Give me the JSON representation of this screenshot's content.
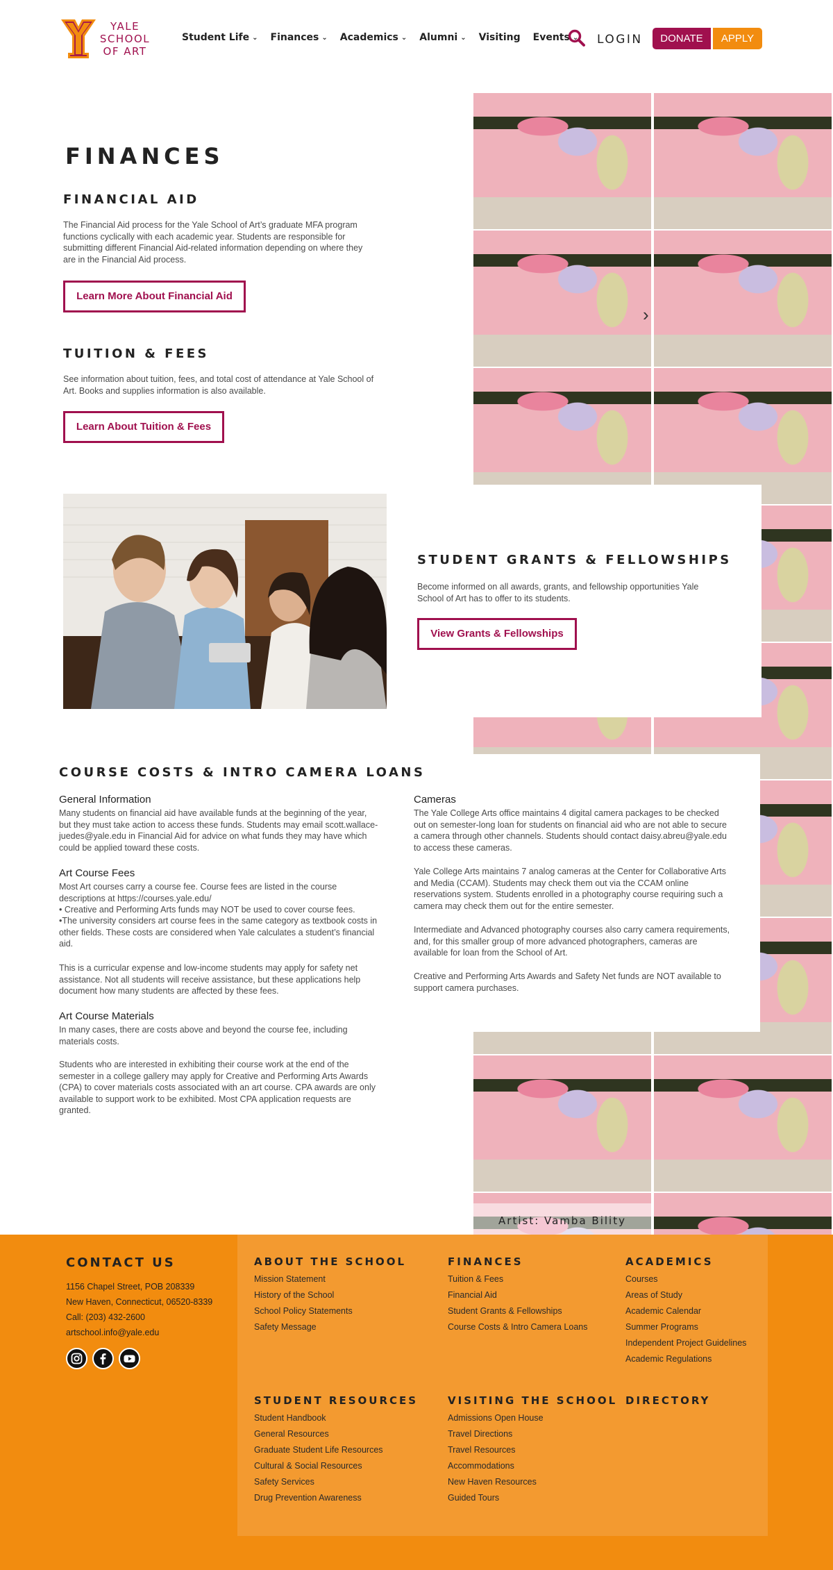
{
  "header": {
    "logo_letter": "Y",
    "logo_lines": [
      "YALE",
      "SCHOOL",
      "OF ART"
    ],
    "nav": [
      {
        "label": "Student Life",
        "dropdown": true
      },
      {
        "label": "Finances",
        "dropdown": true
      },
      {
        "label": "Academics",
        "dropdown": true
      },
      {
        "label": "Alumni",
        "dropdown": true
      },
      {
        "label": "Visiting",
        "dropdown": false
      },
      {
        "label": "Events",
        "dropdown": true
      }
    ],
    "login_label": "LOGIN",
    "donate_label": "DONATE",
    "apply_label": "APPLY"
  },
  "page_title": "FINANCES",
  "financial_aid": {
    "heading": "FINANCIAL AID",
    "body": "The Financial Aid process for the Yale School of Art’s graduate MFA program functions cyclically with each academic year. Students are responsible for submitting different Financial Aid-related information depending on where they are in the Financial Aid process.",
    "button": "Learn More About Financial Aid"
  },
  "tuition": {
    "heading": "TUITION & FEES",
    "body": "See information about tuition, fees, and total cost of attendance at Yale School of Art. Books and supplies information is also available.",
    "button": "Learn About Tuition & Fees"
  },
  "grants": {
    "heading": "STUDENT GRANTS & FELLOWSHIPS",
    "body": "Become informed on all awards, grants, and fellowship opportunities Yale School of Art has to offer to its students.",
    "button": "View Grants & Fellowships"
  },
  "course_costs": {
    "heading": "COURSE COSTS & INTRO CAMERA LOANS",
    "general_title": "General Information",
    "general_body": "Many students on financial aid have available funds at the beginning of the year, but they must take action to access these funds. Students may email scott.wallace-juedes@yale.edu in Financial Aid for advice on what funds they may have which could be applied toward these costs.",
    "fees_title": "Art Course Fees",
    "fees_body_1": "Most Art courses carry a course fee. Course fees are listed in the course descriptions at https://courses.yale.edu/",
    "fees_bullet_1": "• Creative and Performing Arts funds may NOT be used to cover course fees.",
    "fees_bullet_2": "•The university considers art course fees in the same category as textbook costs in other fields. These costs are considered when Yale calculates a student’s financial aid.",
    "fees_body_2": "This is a curricular expense and low-income students may apply for safety net assistance. Not all students will receive assistance, but these applications help document how many students are affected by these fees.",
    "materials_title": "Art Course Materials",
    "materials_body_1": "In many cases, there are costs above and beyond the course fee, including materials costs.",
    "materials_body_2": "Students who are interested in exhibiting their course work at the end of the semester in a college gallery may apply for Creative and Performing Arts Awards (CPA) to cover materials costs associated with an art course. CPA awards are only available to support work to be exhibited. Most CPA application requests are granted.",
    "cameras_title": "Cameras",
    "cameras_body_1": "The Yale College Arts office maintains 4 digital camera packages to be checked out on semester-long loan for students on financial aid who are not able to secure a camera through other channels. Students should contact daisy.abreu@yale.edu to access these cameras.",
    "cameras_body_2": "Yale College Arts maintains 7 analog cameras at the Center for Collaborative Arts and Media (CCAM). Students may check them out via the CCAM online reservations system. Students enrolled in a photography course requiring such a camera may check them out for the entire semester.",
    "cameras_body_3": "Intermediate and Advanced photography courses also carry camera requirements, and, for this smaller group of more advanced photographers, cameras are available for loan from the School of Art.",
    "cameras_body_4": "Creative and Performing Arts Awards and Safety Net funds are NOT available to support camera purchases."
  },
  "artist_credit": "Artist: Vamba Bility",
  "footer": {
    "contact_title": "CONTACT US",
    "contact_lines": [
      "1156 Chapel Street, POB 208339",
      "New Haven, Connecticut, 06520-8339",
      "Call: (203) 432-2600",
      "artschool.info@yale.edu"
    ],
    "social": [
      "instagram-icon",
      "facebook-icon",
      "youtube-icon"
    ],
    "columns": [
      {
        "title": "ABOUT THE SCHOOL",
        "links": [
          "Mission Statement",
          "History of the School",
          "School Policy Statements",
          "Safety Message"
        ]
      },
      {
        "title": "FINANCES",
        "links": [
          "Tuition & Fees",
          "Financial Aid",
          "Student Grants & Fellowships",
          "Course Costs & Intro Camera Loans"
        ]
      },
      {
        "title": "ACADEMICS",
        "links": [
          "Courses",
          "Areas of Study",
          "Academic Calendar",
          "Summer Programs",
          "Independent Project Guidelines",
          "Academic Regulations"
        ]
      },
      {
        "title": "STUDENT RESOURCES",
        "links": [
          "Student Handbook",
          "General Resources",
          "Graduate Student Life Resources",
          "Cultural & Social Resources",
          "Safety Services",
          "Drug Prevention Awareness"
        ]
      },
      {
        "title": "VISITING THE SCHOOL",
        "links": [
          "Admissions Open House",
          "Travel Directions",
          "Travel Resources",
          "Accommodations",
          "New Haven Resources",
          "Guided Tours"
        ]
      },
      {
        "title": "DIRECTORY",
        "links": []
      }
    ]
  },
  "colors": {
    "brand_magenta": "#a0104e",
    "brand_orange": "#f28c0f",
    "footer_panel": "#f39a30"
  }
}
